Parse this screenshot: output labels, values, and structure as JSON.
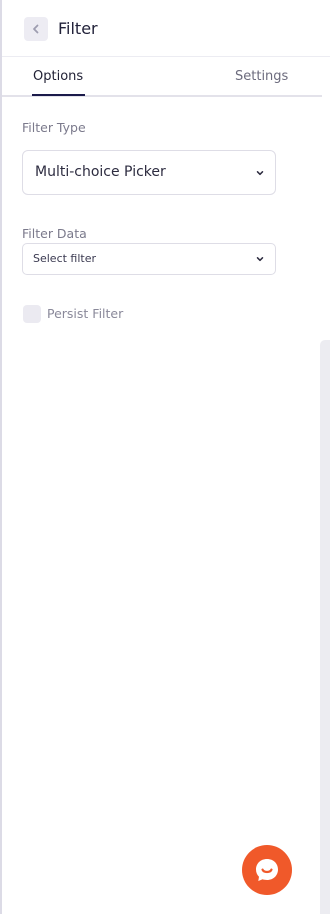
{
  "header": {
    "title": "Filter",
    "back_icon": "chevron-left-icon"
  },
  "tabs": [
    {
      "label": "Options",
      "active": true
    },
    {
      "label": "Settings",
      "active": false
    }
  ],
  "fields": {
    "filter_type": {
      "label": "Filter Type",
      "value": "Multi-choice Picker"
    },
    "filter_data": {
      "label": "Filter Data",
      "value": "Select filter"
    },
    "persist_filter": {
      "label": "Persist Filter",
      "checked": false
    }
  },
  "chat_button": {
    "icon": "chat-bubble-smile-icon",
    "color": "#f0592a"
  },
  "colors": {
    "accent": "#1b1a4a",
    "chat": "#f0592a"
  }
}
